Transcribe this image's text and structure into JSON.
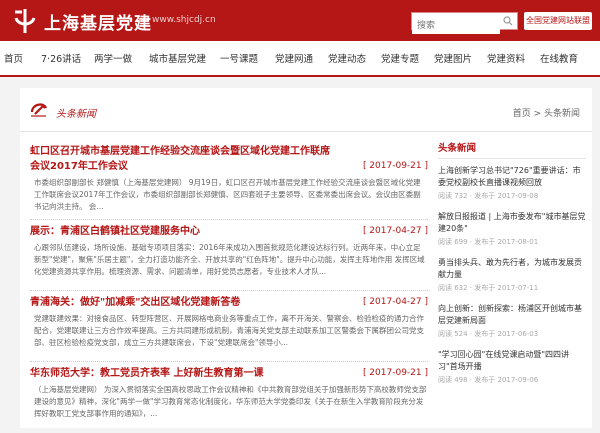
{
  "header": {
    "site_name": "上海基层党建",
    "site_url": "www.shjcdj.cn",
    "search_placeholder": "搜索",
    "alliance_button": "全国党建网站联盟",
    "brand_color": "#b51616"
  },
  "nav": {
    "items": [
      "首页",
      "7·26讲话",
      "两学一做",
      "城市基层党建",
      "一号课题",
      "党建网通",
      "党建动态",
      "党建专题",
      "党建图片",
      "党建资料",
      "在线教育"
    ]
  },
  "section": {
    "label": "头条新闻",
    "breadcrumb": "首页 > 头条新闻"
  },
  "articles": [
    {
      "title": "虹口区召开城市基层党建工作经验交流座谈会暨区域化党建工作联席会议2017年工作会议",
      "date": "[ 2017-09-21 ]",
      "summary": "市委组织部副部长 郑健慎（上海基层党建网） 9月19日，虹口区召开城市基层党建工作经验交流座谈会暨区域化党建工作联席会议2017年工作会议，市委组织部副部长郑健慎、区四套班子主要领导、区委常委出席会议。会议由区委副书记向洪主持。 会..."
    },
    {
      "title": "展示：青浦区白鹤镇社区党建服务中心",
      "date": "[ 2017-04-27 ]",
      "summary": "心跟邻队伍建设，场所设施、基础专项项目落实：2016年来成功入围首批规范化建设达标行列。近两年来，中心立足新型\"党建\"，聚焦\"乐居主题\"，全力打造功能齐全、开放共享的\"红色阵地\"。提升中心功能，发挥主阵地作用 发挥区域化党建资源共享作用。梳理资源、需求、问题清单，用好党员志愿者，专业技术人才队..."
    },
    {
      "title": "青浦海关：做好\"加减乘\"交出区域化党建新答卷",
      "date": "[ 2017-04-27 ]",
      "summary": "党建联建效果：对接食品区、转型阵营区、开展网格电商业务等重点工作，离不开海关、警察会、检验检疫的通力合作配合，党建联建让三方合作效率提高。三方共同建形成机制，青浦海关党支部主动联系加工区警委会下属群团公司党支部、驻区检验检疫党支部，成立三方共建联席会，下设\"党建联席会\"领导小..."
    },
    {
      "title": "华东师范大学：教工党员齐表率 上好新生教育第一课",
      "date": "[ 2017-09-21 ]",
      "summary": "（上海基层党建网） 为深入贯彻落实全国高校思政工作会议精神和《中共教育部党组关于加强新形势下高校教师党支部建设的意见》精神，深化\"两学一做\"学习教育常态化制度化，华东师范大学党委印发《关于在新生入学教育阶段充分发挥好教职工党支部事作用的通知》，..."
    }
  ],
  "sidebar": {
    "header": "头条新闻",
    "items": [
      {
        "title": "上海创新学习总书记\"726\"重要讲话：市委党校副校长直播课视频回放",
        "meta": "阅读 732 · 发布于 2017-09-08"
      },
      {
        "title": "解放日报报道 | 上海市委发布\"城市基层党建20条\"",
        "meta": "阅读 699 · 发布于 2017-08-01"
      },
      {
        "title": "勇当排头兵、敢为先行者，为城市发展贡献力量",
        "meta": "阅读 632 · 发布于 2017-07-11"
      },
      {
        "title": "向上创新：创新探索：杨浦区开创城市基层党建新局面",
        "meta": "阅读 524 · 发布于 2017-06-03"
      },
      {
        "title": "\"学习回心园\"在线党课启动暨\"四四讲习\"首场开播",
        "meta": "阅读 498 · 发布于 2017-09-06"
      }
    ]
  }
}
